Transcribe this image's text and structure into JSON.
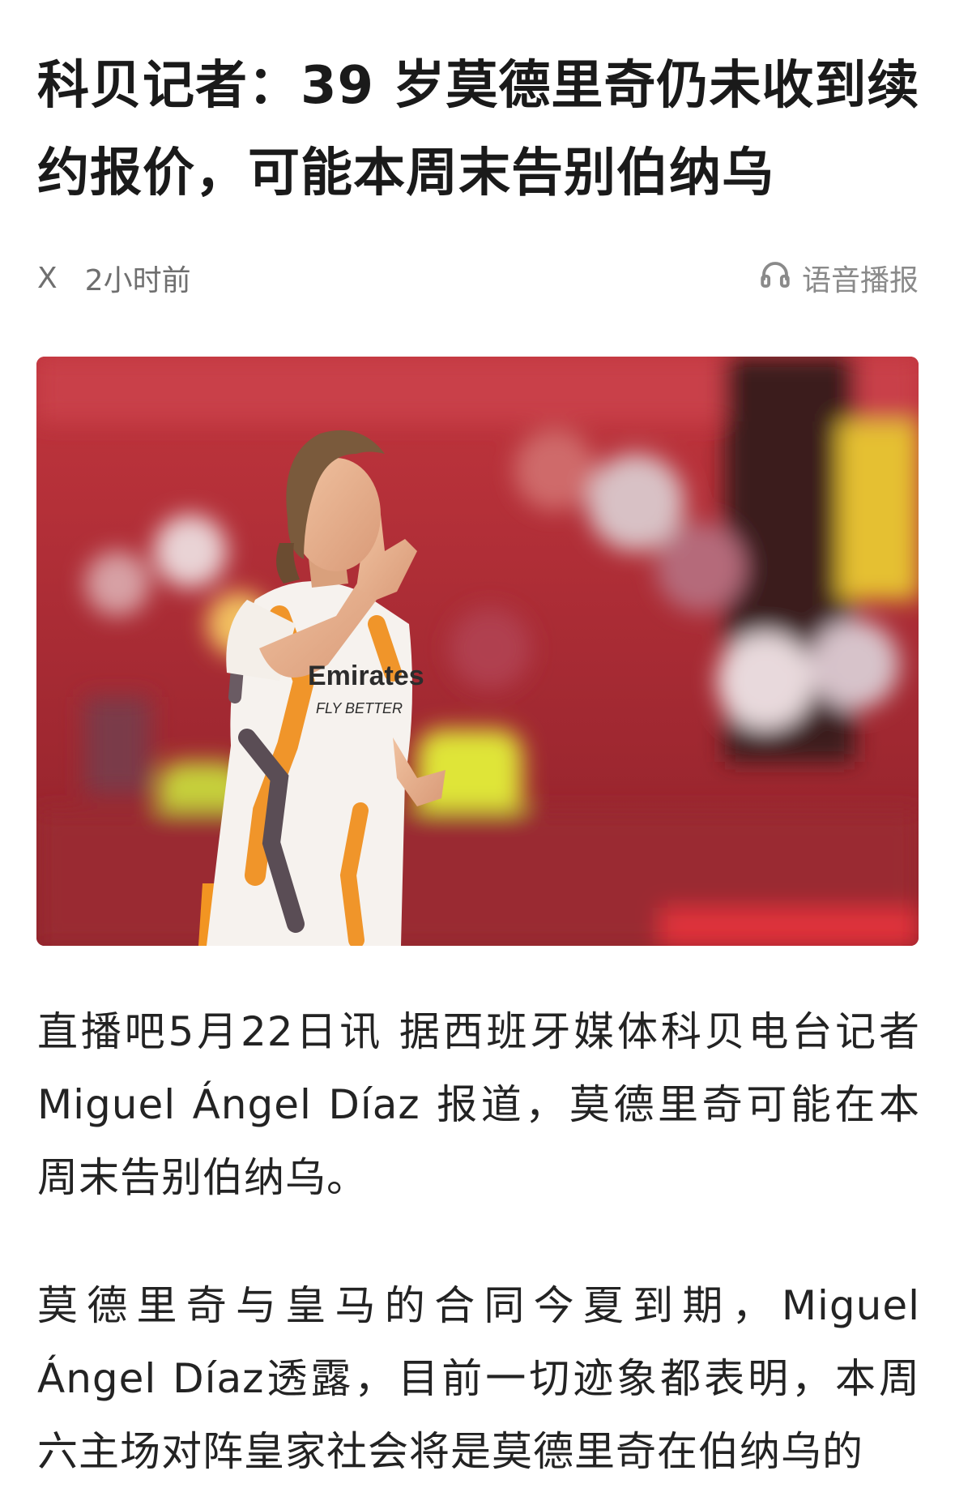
{
  "article": {
    "title": "科贝记者：39 岁莫德里奇仍未收到续约报价，可能本周末告别伯纳乌",
    "meta": {
      "source": "X",
      "time": "2小时前",
      "audio_label": "语音播报"
    },
    "hero_image": {
      "jersey_text": "Emirates",
      "jersey_subtext": "FLY BETTER"
    },
    "paragraphs": [
      "直播吧5月22日讯 据西班牙媒体科贝电台记者 Miguel Ángel Díaz 报道，莫德里奇可能在本周末告别伯纳乌。",
      "莫德里奇与皇马的合同今夏到期，Miguel Ángel Díaz透露，目前一切迹象都表明，本周六主场对阵皇家社会将是莫德里奇在伯纳乌的"
    ]
  },
  "colors": {
    "stadium_red": "#b3323a",
    "jersey_orange": "#f0952a"
  },
  "icons": {
    "audio": "headphones-icon"
  }
}
